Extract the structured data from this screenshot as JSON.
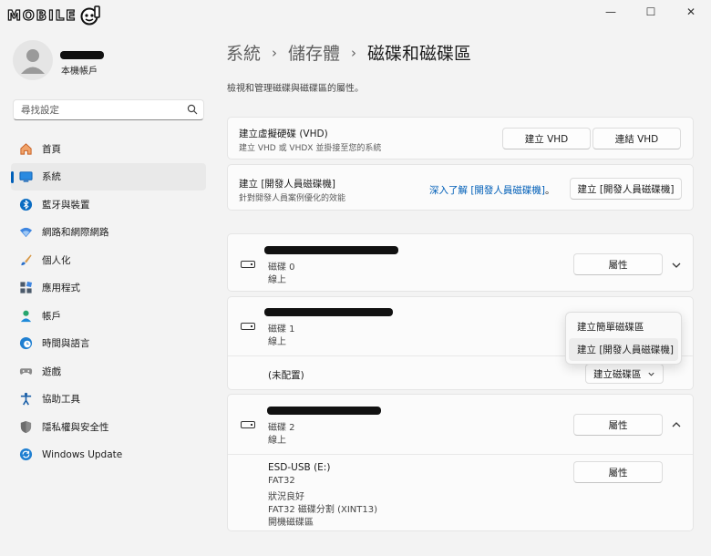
{
  "titlebar": {
    "logo_text": "MOBILE",
    "minimize_glyph": "—",
    "maximize_glyph": "☐",
    "close_glyph": "✕"
  },
  "account": {
    "type": "本機帳戶",
    "avatar_icon": "user-avatar-icon"
  },
  "search": {
    "placeholder": "尋找設定",
    "icon": "search-icon"
  },
  "nav": {
    "items": [
      {
        "label": "首頁",
        "icon": "home-icon",
        "color": "#e2793b"
      },
      {
        "label": "系統",
        "icon": "monitor-icon",
        "color": "#0a6cc2",
        "active": true
      },
      {
        "label": "藍牙與裝置",
        "icon": "bluetooth-icon",
        "color": "#0a6cc2"
      },
      {
        "label": "網路和網際網路",
        "icon": "wifi-icon",
        "color": "#2b6fcf"
      },
      {
        "label": "個人化",
        "icon": "brush-icon",
        "color": "#d37a1d"
      },
      {
        "label": "應用程式",
        "icon": "apps-icon",
        "color": "#4b5a6b"
      },
      {
        "label": "帳戶",
        "icon": "person-icon",
        "color": "#27a56e"
      },
      {
        "label": "時間與語言",
        "icon": "clock-globe-icon",
        "color": "#1f7fd1"
      },
      {
        "label": "遊戲",
        "icon": "gamepad-icon",
        "color": "#7b7b7b"
      },
      {
        "label": "協助工具",
        "icon": "accessibility-icon",
        "color": "#1a5fa8"
      },
      {
        "label": "隱私權與安全性",
        "icon": "shield-icon",
        "color": "#7b7b7b"
      },
      {
        "label": "Windows Update",
        "icon": "update-icon",
        "color": "#1f7fd1"
      }
    ]
  },
  "breadcrumb": {
    "items": [
      "系統",
      "儲存體",
      "磁碟和磁碟區"
    ],
    "separator": "›"
  },
  "page_desc": "檢視和管理磁碟與磁碟區的屬性。",
  "vhd_card": {
    "title": "建立虛擬硬碟 (VHD)",
    "subtitle": "建立 VHD 或 VHDX 並掛接至您的系統",
    "create_label": "建立 VHD",
    "attach_label": "連結 VHD"
  },
  "devdrive_card": {
    "title": "建立 [開發人員磁碟機]",
    "subtitle": "針對開發人員案例優化的效能",
    "link_label": "深入了解 [開發人員磁碟機]",
    "link_suffix": "。",
    "create_label": "建立 [開發人員磁碟機]"
  },
  "disks": [
    {
      "name": "磁碟 0",
      "status": "線上",
      "properties_label": "屬性",
      "expanded": false
    },
    {
      "name": "磁碟 1",
      "status": "線上",
      "unallocated_label": "(未配置)",
      "create_volume_label": "建立磁碟區",
      "menu": [
        "建立簡單磁碟區",
        "建立 [開發人員磁碟機]"
      ]
    },
    {
      "name": "磁碟 2",
      "status": "線上",
      "properties_label": "屬性",
      "expanded": true,
      "volume": {
        "label": "ESD-USB (E:)",
        "filesystem": "FAT32",
        "health": "狀況良好",
        "partition": "FAT32 磁碟分割 (XINT13)",
        "type": "開機磁碟區",
        "properties_label": "屬性"
      }
    }
  ],
  "colors": {
    "accent": "#005fb8",
    "background": "#f3f3f3",
    "card": "#fbfbfb"
  }
}
